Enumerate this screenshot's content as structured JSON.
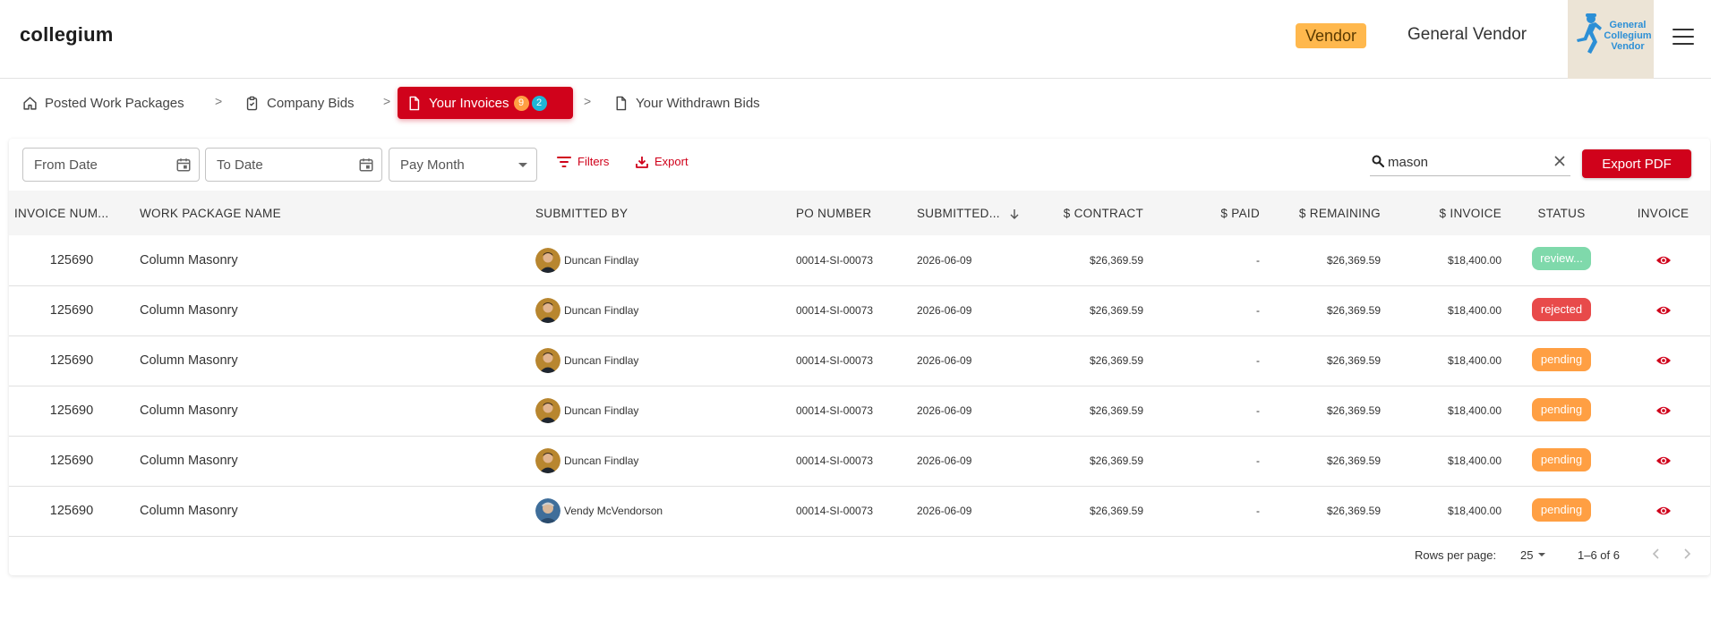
{
  "header": {
    "brand": "collegium",
    "role_badge": "Vendor",
    "user_name": "General Vendor",
    "logo_lines": [
      "General",
      "Collegium",
      "Vendor"
    ]
  },
  "nav": {
    "items": [
      {
        "label": "Posted Work Packages",
        "icon": "home-icon"
      },
      {
        "label": "Company Bids",
        "icon": "clipboard-icon"
      },
      {
        "label": "Your Invoices",
        "icon": "document-icon",
        "active": true,
        "badges": [
          "9",
          "2"
        ]
      },
      {
        "label": "Your Withdrawn Bids",
        "icon": "document-icon"
      }
    ],
    "separator": ">"
  },
  "toolbar": {
    "from_date_placeholder": "From Date",
    "to_date_placeholder": "To Date",
    "pay_month_label": "Pay Month",
    "filters_label": "Filters",
    "export_label": "Export",
    "search_value": "mason",
    "export_pdf_label": "Export PDF"
  },
  "table": {
    "columns": [
      "INVOICE NUM...",
      "WORK PACKAGE NAME",
      "SUBMITTED BY",
      "PO NUMBER",
      "SUBMITTED...",
      "$ CONTRACT",
      "$ PAID",
      "$ REMAINING",
      "$ INVOICE",
      "STATUS",
      "INVOICE"
    ],
    "rows": [
      {
        "invoice": "125690",
        "work_package": "Column Masonry",
        "submitted_by": "Duncan Findlay",
        "po": "00014-SI-00073",
        "submitted": "2026-06-09",
        "contract": "$26,369.59",
        "paid": "-",
        "remaining": "$26,369.59",
        "amount": "$18,400.00",
        "status": "review..."
      },
      {
        "invoice": "125690",
        "work_package": "Column Masonry",
        "submitted_by": "Duncan Findlay",
        "po": "00014-SI-00073",
        "submitted": "2026-06-09",
        "contract": "$26,369.59",
        "paid": "-",
        "remaining": "$26,369.59",
        "amount": "$18,400.00",
        "status": "rejected"
      },
      {
        "invoice": "125690",
        "work_package": "Column Masonry",
        "submitted_by": "Duncan Findlay",
        "po": "00014-SI-00073",
        "submitted": "2026-06-09",
        "contract": "$26,369.59",
        "paid": "-",
        "remaining": "$26,369.59",
        "amount": "$18,400.00",
        "status": "pending"
      },
      {
        "invoice": "125690",
        "work_package": "Column Masonry",
        "submitted_by": "Duncan Findlay",
        "po": "00014-SI-00073",
        "submitted": "2026-06-09",
        "contract": "$26,369.59",
        "paid": "-",
        "remaining": "$26,369.59",
        "amount": "$18,400.00",
        "status": "pending"
      },
      {
        "invoice": "125690",
        "work_package": "Column Masonry",
        "submitted_by": "Duncan Findlay",
        "po": "00014-SI-00073",
        "submitted": "2026-06-09",
        "contract": "$26,369.59",
        "paid": "-",
        "remaining": "$26,369.59",
        "amount": "$18,400.00",
        "status": "pending"
      },
      {
        "invoice": "125690",
        "work_package": "Column Masonry",
        "submitted_by": "Vendy McVendorson",
        "po": "00014-SI-00073",
        "submitted": "2026-06-09",
        "contract": "$26,369.59",
        "paid": "-",
        "remaining": "$26,369.59",
        "amount": "$18,400.00",
        "status": "pending"
      }
    ]
  },
  "pagination": {
    "rows_per_page_label": "Rows per page:",
    "rows_per_page": "25",
    "range": "1–6 of 6"
  },
  "colors": {
    "accent": "#d0021b",
    "vendor_badge": "#ffb84d",
    "status_review": "#7fd9ab",
    "status_rejected": "#e84a4a",
    "status_pending": "#ff9f43",
    "badge_orange": "#ff9f43",
    "badge_cyan": "#1fb6d6"
  }
}
